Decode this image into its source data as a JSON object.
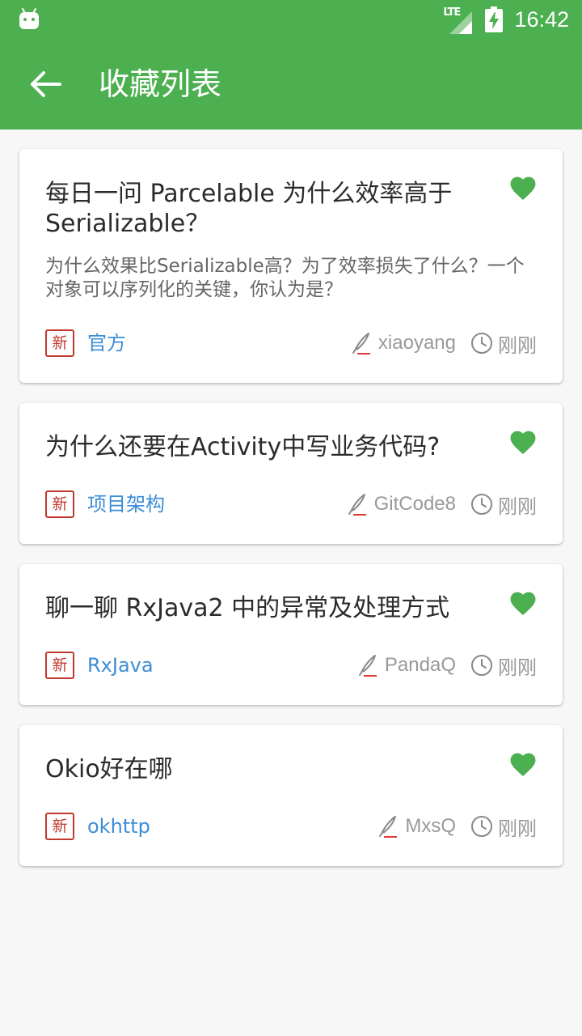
{
  "status_bar": {
    "network": "LTE",
    "time": "16:42"
  },
  "app_bar": {
    "title": "收藏列表"
  },
  "articles": [
    {
      "title": "每日一问 Parcelable 为什么效率高于 Serializable？",
      "desc": "为什么效果比Serializable高？为了效率损失了什么？一个对象可以序列化的关键，你认为是？",
      "badge": "新",
      "category": "官方",
      "author": "xiaoyang",
      "time": "刚刚"
    },
    {
      "title": "为什么还要在Activity中写业务代码?",
      "badge": "新",
      "category": "项目架构",
      "author": "GitCode8",
      "time": "刚刚"
    },
    {
      "title": "聊一聊 RxJava2 中的异常及处理方式",
      "badge": "新",
      "category": "RxJava",
      "author": "PandaQ",
      "time": "刚刚"
    },
    {
      "title": "Okio好在哪",
      "badge": "新",
      "category": "okhttp",
      "author": "MxsQ",
      "time": "刚刚"
    }
  ],
  "colors": {
    "primary": "#4CAF50",
    "favorite": "#4CAF50",
    "category": "#3C8DD5",
    "badge": "#C0392B"
  },
  "icons": {
    "status_left": "android-icon",
    "signal": "signal-icon",
    "battery": "battery-charging-icon",
    "back": "arrow-left-icon",
    "favorite": "heart-icon",
    "author": "pen-icon",
    "time": "clock-icon"
  }
}
